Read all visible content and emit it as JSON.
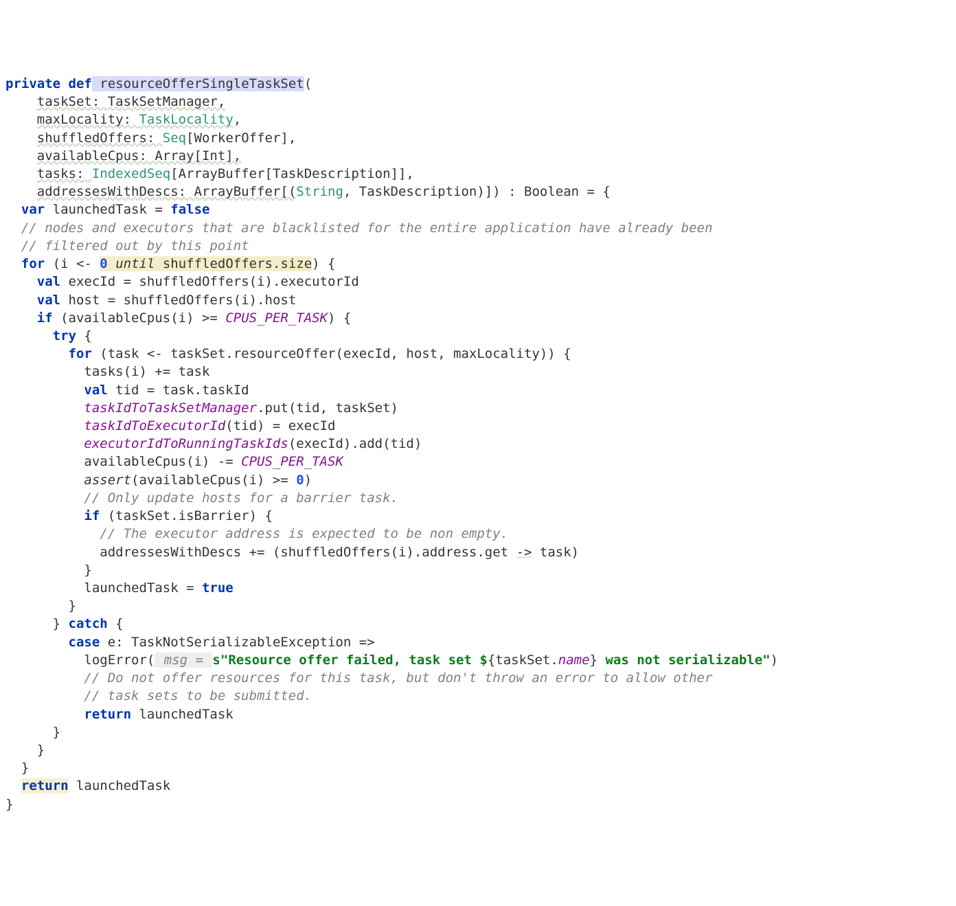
{
  "code": {
    "l1_private": "private",
    "l1_def": "def",
    "l1_fn": " resourceOfferSingleTaskSet",
    "l1_open": "(",
    "l2_indent": "    ",
    "l2_a": "taskSet: TaskSetManager,",
    "l3_a": "maxLocality: ",
    "l3_type": "TaskLocality",
    "l3_b": ",",
    "l4_a": "shuffledOffers: ",
    "l4_type": "Seq",
    "l4_b": "[WorkerOffer],",
    "l5_a": "availableCpus: Array[Int],",
    "l6_a": "tasks: ",
    "l6_type": "IndexedSeq",
    "l6_b": "[ArrayBuffer[TaskDescription]],",
    "l7_a": "addressesWithDescs: ArrayBuffer[(",
    "l7_type": "String",
    "l7_b": ", TaskDescription)]) : Boolean = {",
    "l8_indent": "  ",
    "l8_var": "var",
    "l8_a": " launchedTask = ",
    "l8_false": "false",
    "l9": "  // nodes and executors that are blacklisted for the entire application have already been",
    "l10": "  // filtered out by this point",
    "l11_a": "  ",
    "l11_for": "for",
    "l11_b": " (i <- ",
    "l11_zero": "0",
    "l11_until": " until ",
    "l11_c": "shuffledOffers.size",
    "l11_d": ") {",
    "l12_a": "    ",
    "l12_val": "val",
    "l12_b": " execId = shuffledOffers(i).executorId",
    "l13_a": "    ",
    "l13_val": "val",
    "l13_b": " host = shuffledOffers(i).host",
    "l14_a": "    ",
    "l14_if": "if",
    "l14_b": " (availableCpus(i) >= ",
    "l14_const": "CPUS_PER_TASK",
    "l14_c": ") {",
    "l15_a": "      ",
    "l15_try": "try",
    "l15_b": " {",
    "l16_a": "        ",
    "l16_for": "for",
    "l16_b": " (task <- taskSet.resourceOffer(execId, host, maxLocality)) {",
    "l17": "          tasks(i) += task",
    "l18_a": "          ",
    "l18_val": "val",
    "l18_b": " tid = task.taskId",
    "l19_a": "          ",
    "l19_field": "taskIdToTaskSetManager",
    "l19_b": ".put(tid, taskSet)",
    "l20_a": "          ",
    "l20_field": "taskIdToExecutorId",
    "l20_b": "(tid) = execId",
    "l21_a": "          ",
    "l21_field": "executorIdToRunningTaskIds",
    "l21_b": "(execId).add(tid)",
    "l22_a": "          availableCpus(i) -= ",
    "l22_const": "CPUS_PER_TASK",
    "l23_a": "          ",
    "l23_assert": "assert",
    "l23_b": "(availableCpus(i) >= ",
    "l23_zero": "0",
    "l23_c": ")",
    "l24": "          // Only update hosts for a barrier task.",
    "l25_a": "          ",
    "l25_if": "if",
    "l25_b": " (taskSet.isBarrier) {",
    "l26": "            // The executor address is expected to be non empty.",
    "l27_a": "            addressesWithDescs += (shuffledOffers(i).address.get ",
    "l27_arrow": "->",
    "l27_b": " task)",
    "l28": "          }",
    "l29_a": "          launchedTask = ",
    "l29_true": "true",
    "l30": "        }",
    "l31_a": "      } ",
    "l31_catch": "catch",
    "l31_b": " {",
    "l32_a": "        ",
    "l32_case": "case",
    "l32_b": " e: TaskNotSerializableException =>",
    "l33_a": "          logError(",
    "l33_msg": " msg = ",
    "l33_s": "s",
    "l33_str1": "\"Resource offer failed, task set ",
    "l33_esc1": "$",
    "l33_interp": "{taskSet.",
    "l33_name": "name",
    "l33_interp2": "}",
    "l33_str2": " was not serializable\"",
    "l33_b": ")",
    "l34": "          // Do not offer resources for this task, but don't throw an error to allow other",
    "l35": "          // task sets to be submitted.",
    "l36_a": "          ",
    "l36_ret": "return",
    "l36_b": " launchedTask",
    "l37": "      }",
    "l39": "    }",
    "l40": "  }",
    "l41_a": "  ",
    "l41_ret": "return",
    "l41_b": " launchedTask",
    "l42": "}"
  }
}
